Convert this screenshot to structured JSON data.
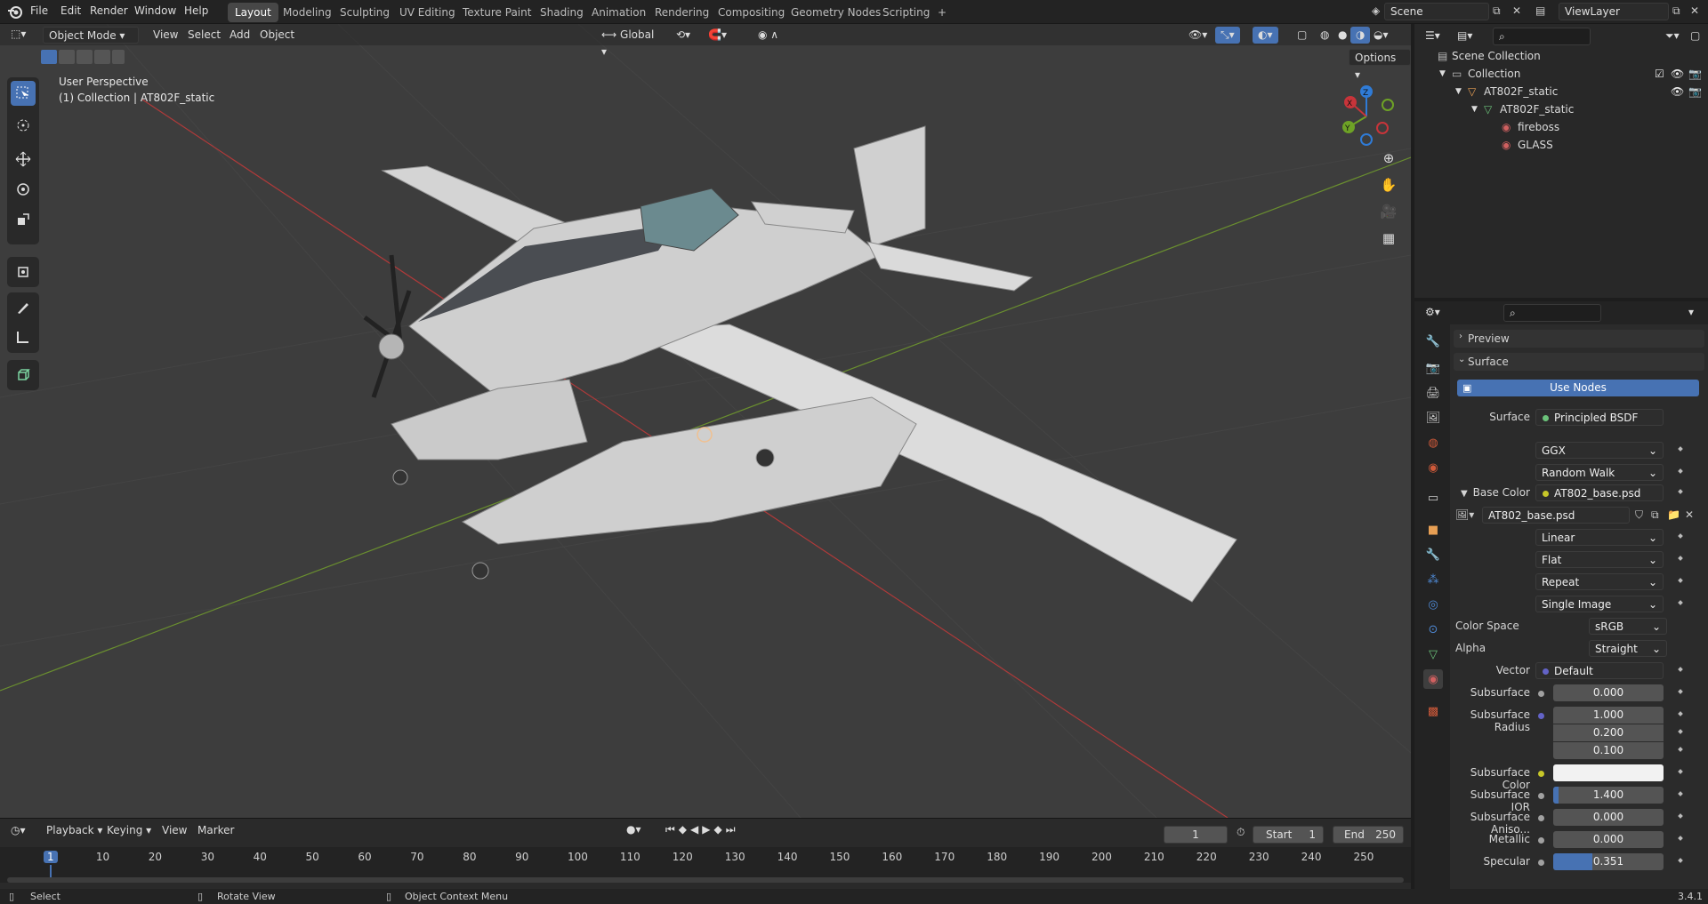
{
  "topbar": {
    "menus": [
      "File",
      "Edit",
      "Render",
      "Window",
      "Help"
    ],
    "tabs": [
      "Layout",
      "Modeling",
      "Sculpting",
      "UV Editing",
      "Texture Paint",
      "Shading",
      "Animation",
      "Rendering",
      "Compositing",
      "Geometry Nodes",
      "Scripting"
    ],
    "active_tab": "Layout",
    "scene": "Scene",
    "view_layer": "ViewLayer",
    "add_tab": "+"
  },
  "viewport": {
    "mode": "Object Mode",
    "menus": [
      "View",
      "Select",
      "Add",
      "Object"
    ],
    "orientation": "Global",
    "options": "Options",
    "overlay_title": "User Perspective",
    "overlay_collection": "(1) Collection | AT802F_static",
    "gizmo": {
      "x": "X",
      "y": "Y",
      "z": "Z"
    }
  },
  "outliner": {
    "root": "Scene Collection",
    "items": [
      {
        "label": "Collection"
      },
      {
        "label": "AT802F_static"
      },
      {
        "label": "AT802F_static"
      },
      {
        "label": "fireboss"
      },
      {
        "label": "GLASS"
      }
    ]
  },
  "properties": {
    "preview": "Preview",
    "surface_panel": "Surface",
    "use_nodes": "Use Nodes",
    "surface_label": "Surface",
    "surface_value": "Principled BSDF",
    "distribution": "GGX",
    "subsurface_method": "Random Walk",
    "base_color_label": "Base Color",
    "base_color_value": "AT802_base.psd",
    "image_name": "AT802_base.psd",
    "interpolation": "Linear",
    "projection": "Flat",
    "extension": "Repeat",
    "source": "Single Image",
    "color_space_label": "Color Space",
    "color_space": "sRGB",
    "alpha_label": "Alpha",
    "alpha": "Straight",
    "vector_label": "Vector",
    "vector": "Default",
    "subsurface_label": "Subsurface",
    "subsurface": "0.000",
    "subsurface_radius_label": "Subsurface Radius",
    "radius": [
      "1.000",
      "0.200",
      "0.100"
    ],
    "subsurface_color_label": "Subsurface Color",
    "subsurface_ior_label": "Subsurface IOR",
    "subsurface_ior": "1.400",
    "subsurface_aniso_label": "Subsurface Aniso...",
    "subsurface_aniso": "0.000",
    "metallic_label": "Metallic",
    "metallic": "0.000",
    "specular_label": "Specular",
    "specular": "0.351",
    "specular_fraction": 0.351,
    "subsurface_ior_fraction": 0.05
  },
  "timeline": {
    "menus": [
      "Playback",
      "Keying",
      "View",
      "Marker"
    ],
    "current_frame": "1",
    "start_label": "Start",
    "start": "1",
    "end_label": "End",
    "end": "250",
    "ruler": [
      "1",
      "10",
      "20",
      "30",
      "40",
      "50",
      "60",
      "70",
      "80",
      "90",
      "100",
      "110",
      "120",
      "130",
      "140",
      "150",
      "160",
      "170",
      "180",
      "190",
      "200",
      "210",
      "220",
      "230",
      "240",
      "250"
    ]
  },
  "statusbar": {
    "select": "Select",
    "rotate": "Rotate View",
    "context": "Object Context Menu",
    "version": "3.4.1"
  },
  "colors": {
    "accent": "#4772b3",
    "axis_x": "#c8343a",
    "axis_y": "#6ea226",
    "axis_z": "#2f7bd6"
  }
}
